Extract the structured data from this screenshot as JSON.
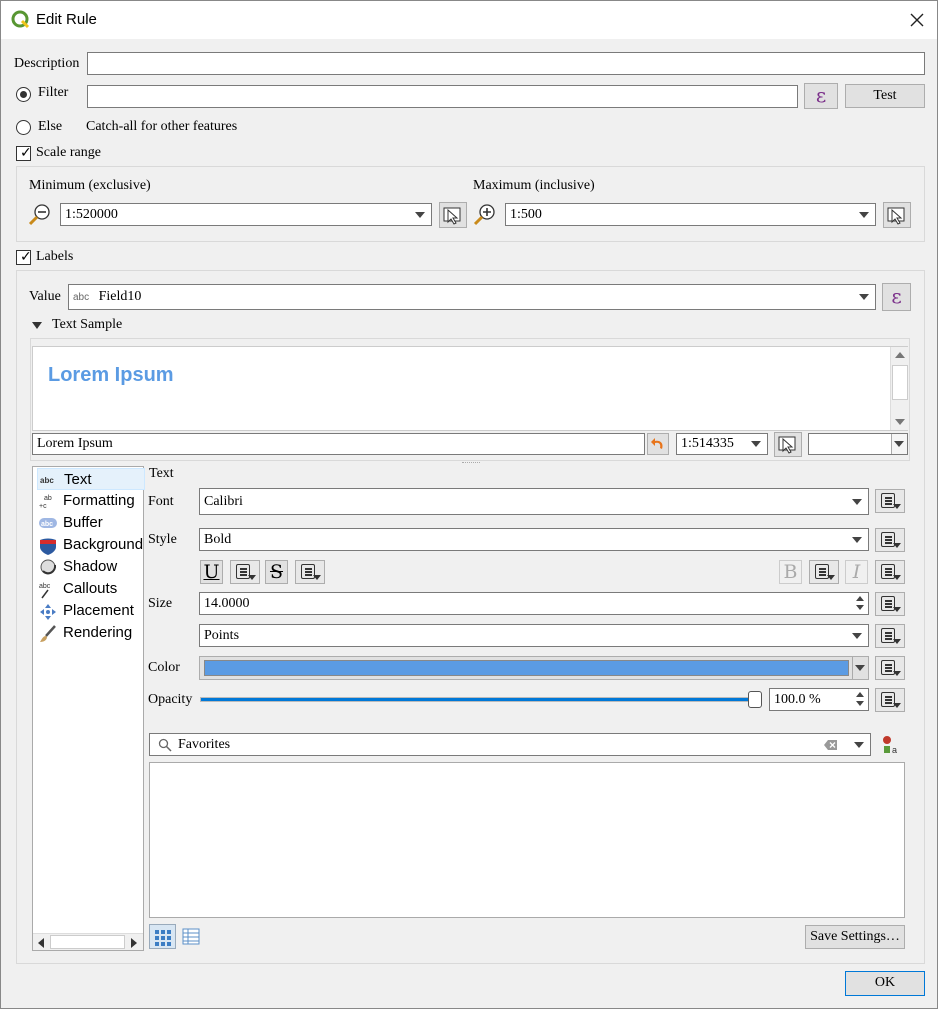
{
  "window": {
    "title": "Edit Rule"
  },
  "rule": {
    "description_label": "Description",
    "description_value": "",
    "filter_label": "Filter",
    "filter_value": "",
    "expression_symbol": "ε",
    "test_label": "Test",
    "else_label": "Else",
    "else_desc": "Catch-all for other features",
    "scale_range_label": "Scale range",
    "scale_range_checked": true,
    "min_label": "Minimum (exclusive)",
    "min_value": "1:520000",
    "max_label": "Maximum (inclusive)",
    "max_value": "1:500"
  },
  "labels": {
    "labels_label": "Labels",
    "labels_checked": true,
    "value_label": "Value",
    "value_badge": "abc",
    "value_field": "Field10",
    "text_sample_label": "Text Sample",
    "preview_text": "Lorem Ipsum",
    "sample_input": "Lorem Ipsum",
    "sample_scale": "1:514335"
  },
  "sidebar": {
    "items": [
      {
        "label": "Text",
        "icon": "text-abc-icon"
      },
      {
        "label": "Formatting",
        "icon": "formatting-icon"
      },
      {
        "label": "Buffer",
        "icon": "buffer-icon"
      },
      {
        "label": "Background",
        "icon": "background-shield-icon"
      },
      {
        "label": "Shadow",
        "icon": "shadow-icon"
      },
      {
        "label": "Callouts",
        "icon": "callouts-icon"
      },
      {
        "label": "Placement",
        "icon": "placement-icon"
      },
      {
        "label": "Rendering",
        "icon": "rendering-brush-icon"
      }
    ]
  },
  "text_panel": {
    "heading": "Text",
    "font_label": "Font",
    "font_value": "Calibri",
    "style_label": "Style",
    "style_value": "Bold",
    "underline_glyph": "U",
    "strike_glyph": "S",
    "bold_glyph": "B",
    "italic_glyph": "I",
    "size_label": "Size",
    "size_value": "14.0000",
    "unit_value": "Points",
    "color_label": "Color",
    "color_hex": "#5b9be3",
    "opacity_label": "Opacity",
    "opacity_value": "100.0 %",
    "opacity_fraction": 1.0
  },
  "styles": {
    "search_placeholder": "Favorites",
    "save_settings_label": "Save Settings…"
  },
  "footer": {
    "ok_label": "OK"
  },
  "colors": {
    "accent": "#0078d7",
    "preview_text": "#5b9be3",
    "qgis_green": "#589632",
    "expression_purple": "#7b2f8a"
  }
}
